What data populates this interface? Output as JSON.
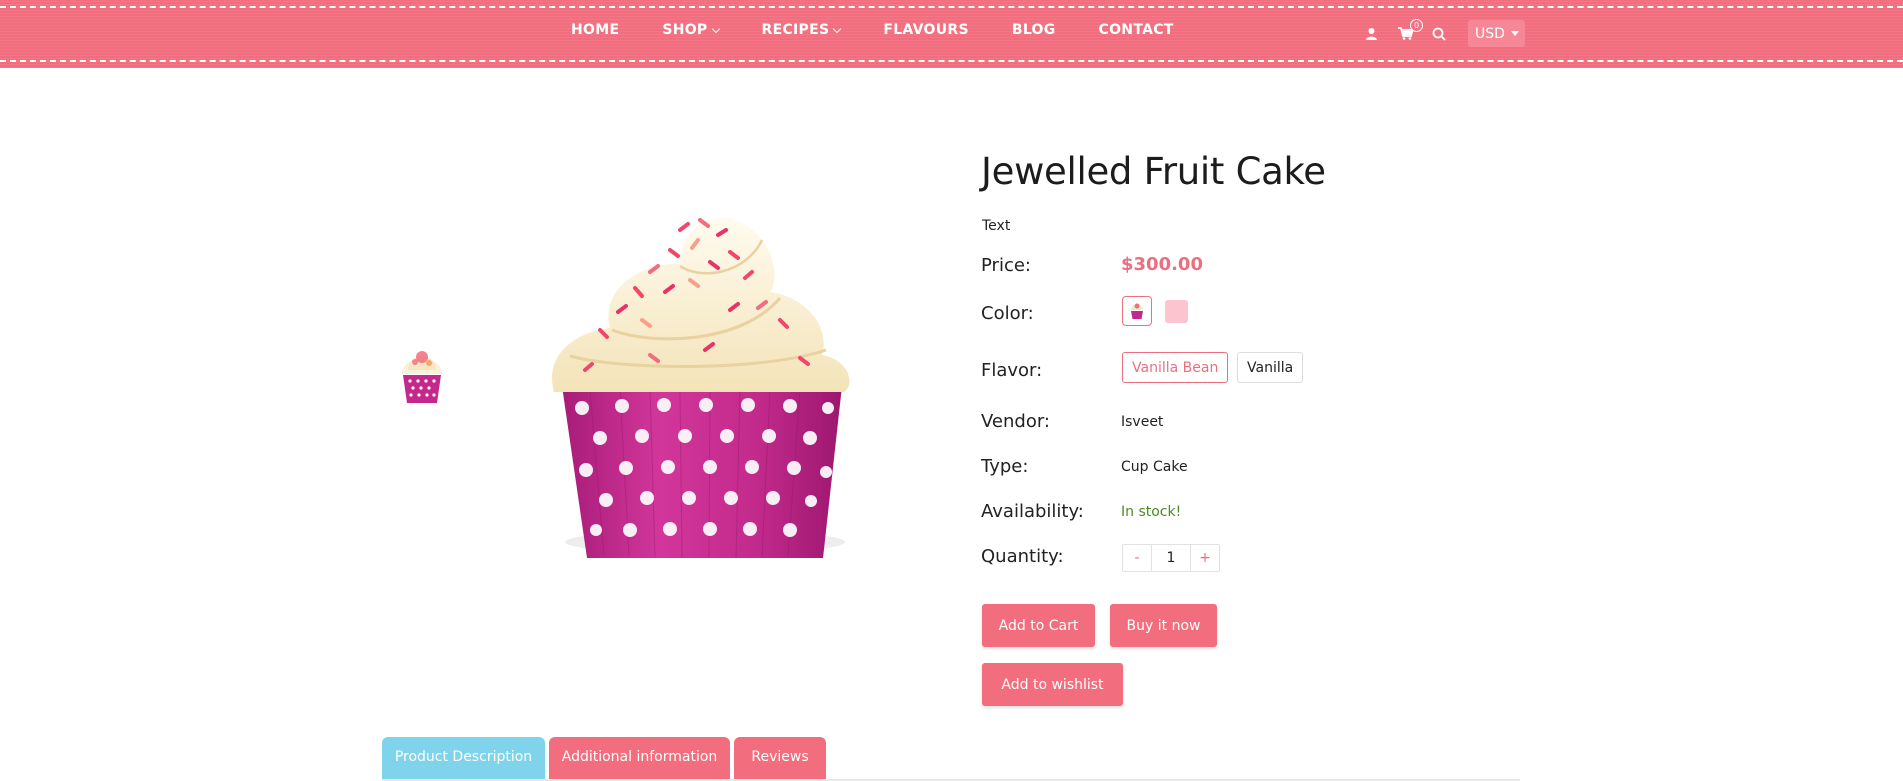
{
  "header": {
    "nav": [
      {
        "label": "HOME",
        "dropdown": false
      },
      {
        "label": "SHOP",
        "dropdown": true
      },
      {
        "label": "RECIPES",
        "dropdown": true
      },
      {
        "label": "FLAVOURS",
        "dropdown": false
      },
      {
        "label": "BLOG",
        "dropdown": false
      },
      {
        "label": "CONTACT",
        "dropdown": false
      }
    ],
    "icons": [
      "user-icon",
      "cart-icon",
      "search-icon"
    ],
    "cart_count": "0",
    "currency": "USD"
  },
  "product": {
    "title": "Jewelled Fruit Cake",
    "sku_text": "Text",
    "price_label": "Price:",
    "price": "$300.00",
    "color_label": "Color:",
    "flavor_label": "Flavor:",
    "flavors": [
      "Vanilla Bean",
      "Vanilla"
    ],
    "vendor_label": "Vendor:",
    "vendor": "Isveet",
    "type_label": "Type:",
    "type": "Cup Cake",
    "availability_label": "Availability:",
    "availability": "In stock!",
    "quantity_label": "Quantity:",
    "qty_minus": "-",
    "quantity": "1",
    "qty_plus": "+"
  },
  "actions": {
    "add_to_cart": "Add to Cart",
    "buy_now": "Buy it now",
    "add_to_wishlist": "Add to wishlist"
  },
  "tabs": [
    "Product Description",
    "Additional information",
    "Reviews"
  ],
  "colors": {
    "brand": "#f26d7d",
    "active_tab": "#7fd3ea",
    "in_stock": "#4a8c20"
  }
}
